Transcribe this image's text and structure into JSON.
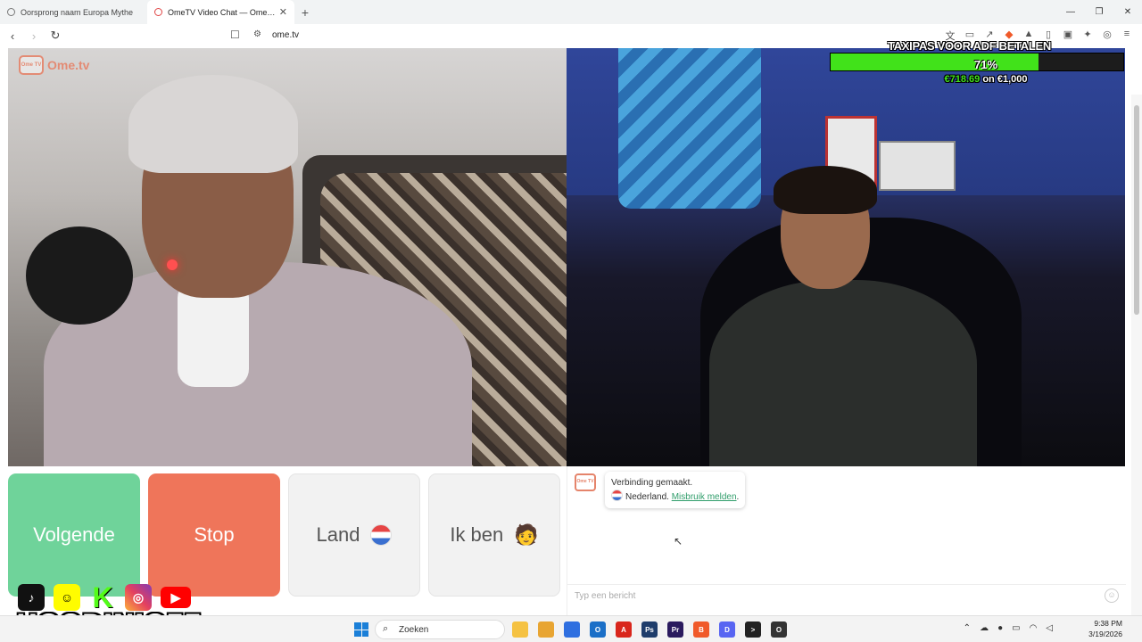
{
  "browser": {
    "tabs": [
      {
        "title": "Oorsprong naam Europa Mythe",
        "active": false
      },
      {
        "title": "OmeTV Video Chat — Omegle",
        "active": true
      }
    ],
    "new_tab": "+",
    "url": "ome.tv",
    "window_controls": [
      "—",
      "❐",
      "✕"
    ]
  },
  "page": {
    "logo_text": "Ome.tv",
    "logo_badge": "Ome TV",
    "goal": {
      "title": "TAXIPAS VOOR ADF BETALEN",
      "percent_label": "71%",
      "percent": 0.71,
      "current": "€718.69",
      "separator": "on",
      "target": "€1,000"
    },
    "buttons": {
      "next": "Volgende",
      "stop": "Stop",
      "country": "Land",
      "iam": "Ik ben",
      "iam_emoji": "🧑"
    },
    "chat": {
      "message_line1": "Verbinding gemaakt.",
      "country": "Nederland.",
      "report_link": "Misbruik melden",
      "report_suffix": ".",
      "input_placeholder": "Typ een bericht"
    }
  },
  "overlay": {
    "streamer_name": "HOODINIOFF",
    "socials": [
      "tiktok",
      "snapchat",
      "kick",
      "instagram",
      "youtube"
    ],
    "kick_letter": "K"
  },
  "taskbar": {
    "search_placeholder": "Zoeken",
    "apps": [
      {
        "name": "file-explorer",
        "label": "",
        "color": "#f5c242"
      },
      {
        "name": "folder",
        "label": "",
        "color": "#e8a532"
      },
      {
        "name": "store",
        "label": "",
        "color": "#2f6fe0"
      },
      {
        "name": "outlook",
        "label": "O",
        "color": "#1b6fc7"
      },
      {
        "name": "acrobat",
        "label": "A",
        "color": "#d9261c"
      },
      {
        "name": "photoshop",
        "label": "Ps",
        "color": "#1f3d6b"
      },
      {
        "name": "premiere",
        "label": "Pr",
        "color": "#2a1a5e"
      },
      {
        "name": "brave",
        "label": "B",
        "color": "#f05a2a"
      },
      {
        "name": "discord",
        "label": "D",
        "color": "#5865f2"
      },
      {
        "name": "cmd",
        "label": ">",
        "color": "#222"
      },
      {
        "name": "obs",
        "label": "O",
        "color": "#333"
      }
    ],
    "time": "9:38 PM",
    "date": "3/19/2026"
  }
}
